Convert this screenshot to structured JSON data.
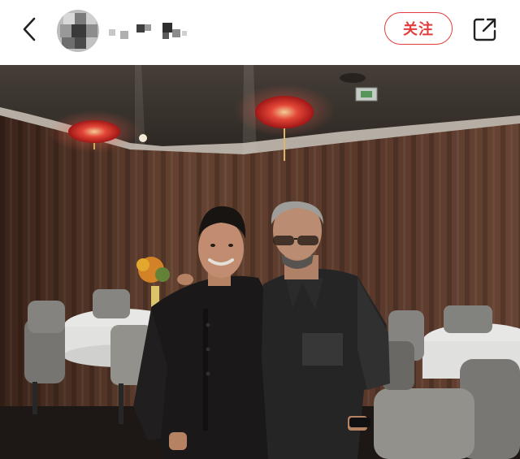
{
  "header": {
    "follow_label": "关注",
    "accent_color": "#e23d3d",
    "icons": {
      "back": "chevron-left-icon",
      "share": "share-external-icon"
    }
  },
  "post": {
    "image_subject": "restaurant-photo",
    "palette": {
      "curtain": "#5a3a2c",
      "ceiling": "#3a3430",
      "lantern": "#e02a2a",
      "tablecloth": "#f2f2f2"
    }
  }
}
